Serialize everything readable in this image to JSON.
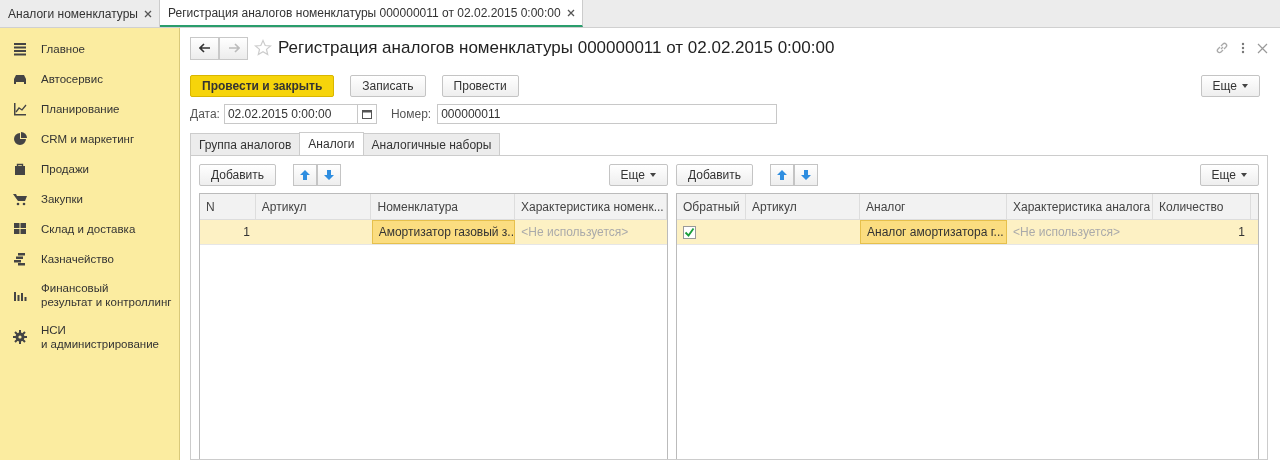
{
  "window_tabs": [
    {
      "label": "Аналоги номенклатуры",
      "selected": false
    },
    {
      "label": "Регистрация аналогов номенклатуры 000000011 от 02.02.2015 0:00:00",
      "selected": true
    }
  ],
  "sidebar": {
    "items": [
      {
        "label": "Главное"
      },
      {
        "label": "Автосервис"
      },
      {
        "label": "Планирование"
      },
      {
        "label": "CRM и маркетинг"
      },
      {
        "label": "Продажи"
      },
      {
        "label": "Закупки"
      },
      {
        "label": "Склад и доставка"
      },
      {
        "label": "Казначейство"
      },
      {
        "label": "Финансовый\nрезультат и контроллинг"
      },
      {
        "label": "НСИ\nи администрирование"
      }
    ]
  },
  "form": {
    "title": "Регистрация аналогов номенклатуры 000000011 от 02.02.2015 0:00:00",
    "buttons": [
      {
        "label": "Провести и закрыть",
        "kind": "primary"
      },
      {
        "label": "Записать",
        "kind": "normal"
      },
      {
        "label": "Провести",
        "kind": "normal"
      }
    ],
    "more_button": "Еще",
    "date": {
      "label": "Дата:",
      "value": "02.02.2015  0:00:00"
    },
    "number": {
      "label": "Номер:",
      "value": "000000011"
    },
    "tabs": [
      {
        "label": "Группа аналогов",
        "selected": false
      },
      {
        "label": "Аналоги",
        "selected": true
      },
      {
        "label": "Аналогичные наборы",
        "selected": false
      }
    ]
  },
  "tables": [
    {
      "add_button": "Добавить",
      "more_button": "Еще",
      "columns": [
        {
          "label": "N"
        },
        {
          "label": "Артикул"
        },
        {
          "label": "Номенклатура"
        },
        {
          "label": "Характеристика номенк..."
        }
      ],
      "rows": [
        {
          "selected": true,
          "cells": [
            {
              "kind": "number",
              "text": "1",
              "current": false
            },
            {
              "kind": "text",
              "text": "",
              "current": false
            },
            {
              "kind": "text",
              "text": "Амортизатор газовый з...",
              "current": true
            },
            {
              "kind": "placeholder",
              "text": "<Не используется>",
              "current": false
            }
          ]
        }
      ]
    },
    {
      "add_button": "Добавить",
      "more_button": "Еще",
      "columns": [
        {
          "label": "Обратный"
        },
        {
          "label": "Артикул"
        },
        {
          "label": "Аналог"
        },
        {
          "label": "Характеристика аналога"
        },
        {
          "label": "Количество"
        }
      ],
      "rows": [
        {
          "selected": true,
          "cells": [
            {
              "kind": "check",
              "checked": true,
              "current": false
            },
            {
              "kind": "text",
              "text": "",
              "current": false
            },
            {
              "kind": "text",
              "text": "Аналог амортизатора г...",
              "current": true
            },
            {
              "kind": "placeholder",
              "text": "<Не используется>",
              "current": false
            },
            {
              "kind": "number",
              "text": "1",
              "current": false
            }
          ]
        }
      ]
    }
  ]
}
